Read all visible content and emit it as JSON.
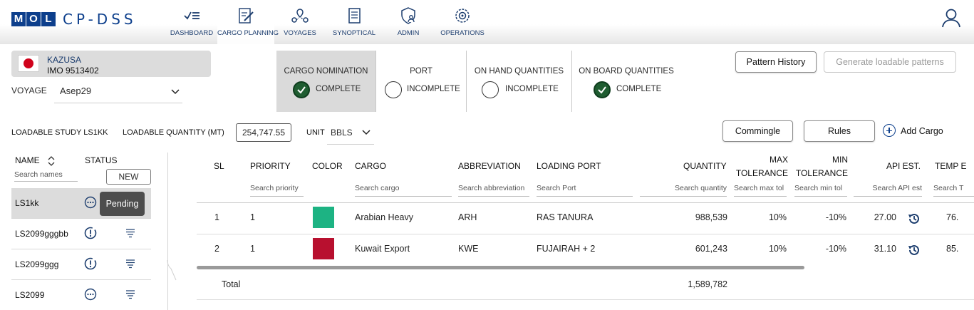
{
  "app": {
    "logo_letters": [
      "M",
      "O",
      "L"
    ],
    "brand": "CP-DSS"
  },
  "nav": [
    {
      "label": "DASHBOARD",
      "icon": "dashboard-check-list-icon"
    },
    {
      "label": "CARGO PLANNING",
      "icon": "cargo-planning-edit-icon",
      "active": true
    },
    {
      "label": "VOYAGES",
      "icon": "voyages-route-icon"
    },
    {
      "label": "SYNOPTICAL",
      "icon": "synoptical-document-icon"
    },
    {
      "label": "ADMIN",
      "icon": "admin-shield-user-icon"
    },
    {
      "label": "OPERATIONS",
      "icon": "operations-gear-icon"
    }
  ],
  "vessel": {
    "name": "KAZUSA",
    "imo": "IMO 9513402",
    "flag": "japan-flag"
  },
  "voyage": {
    "label": "VOYAGE",
    "value": "Asep29"
  },
  "stages": [
    {
      "title": "CARGO NOMINATION",
      "status": "COMPLETE",
      "complete": true,
      "selected": true
    },
    {
      "title": "PORT",
      "status": "INCOMPLETE",
      "complete": false
    },
    {
      "title": "ON HAND QUANTITIES",
      "status": "INCOMPLETE",
      "complete": false
    },
    {
      "title": "ON BOARD QUANTITIES",
      "status": "COMPLETE",
      "complete": true
    }
  ],
  "actions": {
    "pattern_history": "Pattern History",
    "generate": "Generate loadable patterns",
    "commingle": "Commingle",
    "rules": "Rules",
    "add_cargo": "Add Cargo"
  },
  "study": {
    "name_label": "LOADABLE STUDY LS1KK",
    "quantity_label": "LOADABLE QUANTITY (MT)",
    "quantity_value": "254,747.55",
    "unit_label": "UNIT",
    "unit_value": "BBLS"
  },
  "study_list": {
    "name_header": "NAME",
    "status_header": "STATUS",
    "search_placeholder": "Search names",
    "new_button": "NEW",
    "tooltip": "Pending",
    "items": [
      {
        "name": "LS1kk",
        "status": "pending",
        "selected": true
      },
      {
        "name": "LS2099gggbb",
        "status": "error"
      },
      {
        "name": "LS2099ggg",
        "status": "error"
      },
      {
        "name": "LS2099",
        "status": "pending"
      }
    ]
  },
  "table": {
    "headers": {
      "sl": "SL",
      "priority": "PRIORITY",
      "color": "COLOR",
      "cargo": "CARGO",
      "abbreviation": "ABBREVIATION",
      "loading_port": "LOADING PORT",
      "quantity": "QUANTITY",
      "max_tol_1": "MAX",
      "max_tol_2": "TOLERANCE",
      "min_tol_1": "MIN",
      "min_tol_2": "TOLERANCE",
      "api": "API EST.",
      "temp": "TEMP E"
    },
    "search": {
      "priority": "Search priority",
      "cargo": "Search cargo",
      "abbreviation": "Search abbreviation",
      "port": "Search Port",
      "quantity": "Search quantity",
      "max_tol": "Search max tol",
      "min_tol": "Search min tol",
      "api": "Search API est",
      "temp": "Search T"
    },
    "rows": [
      {
        "sl": "1",
        "priority": "1",
        "color": "#1db383",
        "cargo": "Arabian Heavy",
        "abbreviation": "ARH",
        "port": "RAS TANURA",
        "quantity": "988,539",
        "max_tol": "10%",
        "min_tol": "-10%",
        "api": "27.00",
        "temp": "76."
      },
      {
        "sl": "2",
        "priority": "1",
        "color": "#b8102f",
        "cargo": "Kuwait Export",
        "abbreviation": "KWE",
        "port": "FUJAIRAH + 2",
        "quantity": "601,243",
        "max_tol": "10%",
        "min_tol": "-10%",
        "api": "31.10",
        "temp": "85."
      }
    ],
    "total_label": "Total",
    "total_quantity": "1,589,782"
  }
}
